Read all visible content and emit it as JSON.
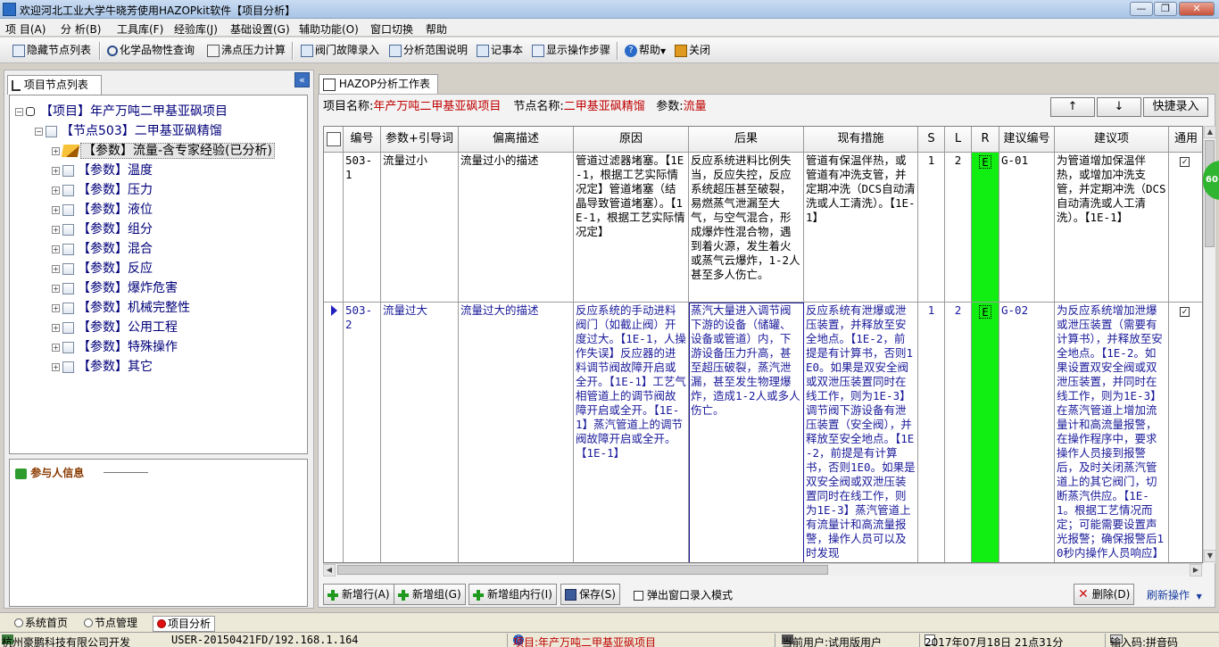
{
  "window": {
    "title": "欢迎河北工业大学牛晓芳使用HAZOPkit软件【项目分析】"
  },
  "menu": [
    "项 目(A)",
    "分 析(B)",
    "工具库(F)",
    "经验库(J)",
    "基础设置(G)",
    "辅助功能(O)",
    "窗口切换",
    "帮助"
  ],
  "toolbar": {
    "hide_nodes": "隐藏节点列表",
    "chem_query": "化学品物性查询",
    "boil_calc": "沸点压力计算",
    "valve_fault": "阀门故障录入",
    "scope_desc": "分析范围说明",
    "notepad": "记事本",
    "show_steps": "显示操作步骤",
    "help": "帮助",
    "close": "关闭"
  },
  "left": {
    "tab": "项目节点列表",
    "tree": [
      {
        "label": "【项目】年产万吨二甲基亚砜项目",
        "pm": "-"
      },
      {
        "label": "【节点503】二甲基亚砜精馏",
        "pm": "-"
      },
      {
        "label": "【参数】流量-含专家经验(已分析)",
        "pm": "+",
        "selected": true
      },
      {
        "label": "【参数】温度",
        "pm": "+"
      },
      {
        "label": "【参数】压力",
        "pm": "+"
      },
      {
        "label": "【参数】液位",
        "pm": "+"
      },
      {
        "label": "【参数】组分",
        "pm": "+"
      },
      {
        "label": "【参数】混合",
        "pm": "+"
      },
      {
        "label": "【参数】反应",
        "pm": "+"
      },
      {
        "label": "【参数】爆炸危害",
        "pm": "+"
      },
      {
        "label": "【参数】机械完整性",
        "pm": "+"
      },
      {
        "label": "【参数】公用工程",
        "pm": "+"
      },
      {
        "label": "【参数】特殊操作",
        "pm": "+"
      },
      {
        "label": "【参数】其它",
        "pm": "+"
      }
    ],
    "participants": "参与人信息"
  },
  "right": {
    "tab": "HAZOP分析工作表",
    "project_label": "项目名称:",
    "project_value": "年产万吨二甲基亚砜项目",
    "node_label": "节点名称:",
    "node_value": "二甲基亚砜精馏",
    "param_label": "参数:",
    "param_value": "流量",
    "up": "↑",
    "down": "↓",
    "quick_entry": "快捷录入"
  },
  "grid": {
    "columns": [
      "",
      "编号",
      "参数+引导词",
      "偏离描述",
      "原因",
      "后果",
      "现有措施",
      "S",
      "L",
      "R",
      "建议编号",
      "建议项",
      "通用"
    ],
    "rows": [
      {
        "id": "503-1",
        "param": "流量过小",
        "deviation": "流量过小的描述",
        "cause": "管道过滤器堵塞。【1E-1，根据工艺实际情况定】管道堵塞（结晶导致管道堵塞）。【1E-1，根据工艺实际情况定】",
        "consequence": "反应系统进料比例失当，反应失控，反应系统超压甚至破裂，易燃蒸气泄漏至大气，与空气混合，形成爆炸性混合物，遇到着火源，发生着火或蒸气云爆炸，1-2人甚至多人伤亡。",
        "measures": "管道有保温伴热，或管道有冲洗支管，并定期冲洗（DCS自动清洗或人工清洗）。【1E-1】",
        "s": "1",
        "l": "2",
        "r": "E",
        "sugg_no": "G-01",
        "suggestion": "为管道增加保温伴热，或增加冲洗支管，并定期冲洗（DCS自动清洗或人工清洗）。【1E-1】",
        "common": "✓"
      },
      {
        "id": "503-2",
        "param": "流量过大",
        "deviation": "流量过大的描述",
        "cause": "反应系统的手动进料阀门（如截止阀）开度过大。【1E-1，人操作失误】反应器的进料调节阀故障开启或全开。【1E-1】工艺气相管道上的调节阀故障开启或全开。【1E-1】蒸汽管道上的调节阀故障开启或全开。【1E-1】",
        "consequence": "蒸汽大量进入调节阀下游的设备（储罐、设备或管道）内，下游设备压力升高，甚至超压破裂，蒸汽泄漏，甚至发生物理爆炸，造成1-2人或多人伤亡。",
        "measures": "反应系统有泄爆或泄压装置，并释放至安全地点。【1E-2，前提是有计算书，否则1E0。如果是双安全阀或双泄压装置同时在线工作，则为1E-3】调节阀下游设备有泄压装置（安全阀），并释放至安全地点。【1E-2，前提是有计算书，否则1E0。如果是双安全阀或双泄压装置同时在线工作，则为1E-3】蒸汽管道上有流量计和高流量报警，操作人员可以及时发现",
        "s": "1",
        "l": "2",
        "r": "E",
        "sugg_no": "G-02",
        "suggestion": "为反应系统增加泄爆或泄压装置（需要有计算书），并释放至安全地点。【1E-2。如果设置双安全阀或双泄压装置，并同时在线工作，则为1E-3】在蒸汽管道上增加流量计和高流量报警，在操作程序中，要求操作人员接到报警后，及时关闭蒸汽管道上的其它阀门，切断蒸汽供应。【1E-1。根据工艺情况而定；可能需要设置声光报警；确保报警后10秒内操作人员响应】",
        "common": "✓"
      }
    ]
  },
  "badge": "60",
  "bottom": {
    "add_row": "新增行(A)",
    "add_group": "新增组(G)",
    "add_in_group": "新增组内行(I)",
    "save": "保存(S)",
    "popup_mode": "弹出窗口录入模式",
    "delete": "删除(D)",
    "refresh": "刷新操作"
  },
  "tabs": {
    "home": "系统首页",
    "node_mgmt": "节点管理",
    "analysis": "项目分析"
  },
  "status": {
    "company": "杭州豪鹏科技有限公司开发",
    "host": "USER-20150421FD/192.168.1.164",
    "project": "项目:年产万吨二甲基亚砜项目",
    "user": "当前用户:试用版用户",
    "datetime": "2017年07月18日 21点31分",
    "ime": "输入码:拼音码"
  },
  "colors": {
    "risk": "#11ee11",
    "accent_red": "#c00000",
    "cell_blue": "#1a1a9a"
  }
}
